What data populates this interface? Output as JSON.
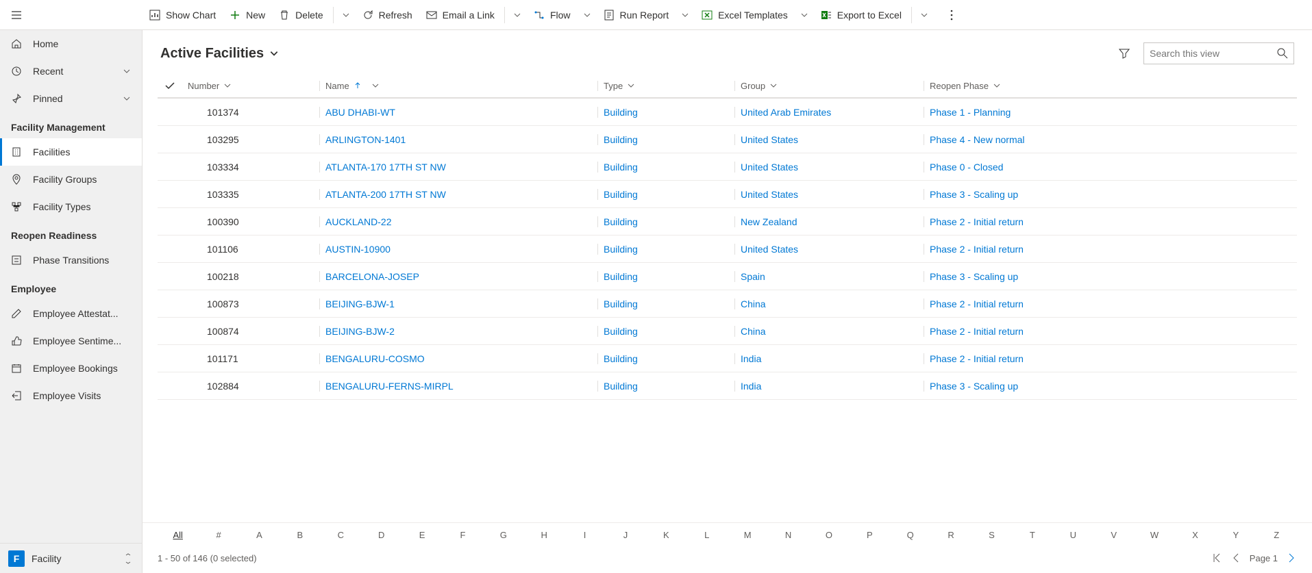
{
  "toolbar": {
    "show_chart": "Show Chart",
    "new": "New",
    "delete": "Delete",
    "refresh": "Refresh",
    "email_link": "Email a Link",
    "flow": "Flow",
    "run_report": "Run Report",
    "excel_templates": "Excel Templates",
    "export_excel": "Export to Excel"
  },
  "sidebar": {
    "top": [
      {
        "label": "Home"
      },
      {
        "label": "Recent"
      },
      {
        "label": "Pinned"
      }
    ],
    "groups": [
      {
        "title": "Facility Management",
        "items": [
          {
            "label": "Facilities",
            "active": true
          },
          {
            "label": "Facility Groups"
          },
          {
            "label": "Facility Types"
          }
        ]
      },
      {
        "title": "Reopen Readiness",
        "items": [
          {
            "label": "Phase Transitions"
          }
        ]
      },
      {
        "title": "Employee",
        "items": [
          {
            "label": "Employee Attestat..."
          },
          {
            "label": "Employee Sentime..."
          },
          {
            "label": "Employee Bookings"
          },
          {
            "label": "Employee Visits"
          }
        ]
      }
    ],
    "footer": {
      "badge": "F",
      "label": "Facility"
    }
  },
  "view": {
    "title": "Active Facilities",
    "search_placeholder": "Search this view"
  },
  "columns": {
    "number": "Number",
    "name": "Name",
    "type": "Type",
    "group": "Group",
    "phase": "Reopen Phase"
  },
  "rows": [
    {
      "number": "101374",
      "name": "ABU DHABI-WT",
      "type": "Building",
      "group": "United Arab Emirates",
      "phase": "Phase 1 - Planning"
    },
    {
      "number": "103295",
      "name": "ARLINGTON-1401",
      "type": "Building",
      "group": "United States",
      "phase": "Phase 4 - New normal"
    },
    {
      "number": "103334",
      "name": "ATLANTA-170 17TH ST NW",
      "type": "Building",
      "group": "United States",
      "phase": "Phase 0 - Closed"
    },
    {
      "number": "103335",
      "name": "ATLANTA-200 17TH ST NW",
      "type": "Building",
      "group": "United States",
      "phase": "Phase 3 - Scaling up"
    },
    {
      "number": "100390",
      "name": "AUCKLAND-22",
      "type": "Building",
      "group": "New Zealand",
      "phase": "Phase 2 - Initial return"
    },
    {
      "number": "101106",
      "name": "AUSTIN-10900",
      "type": "Building",
      "group": "United States",
      "phase": "Phase 2 - Initial return"
    },
    {
      "number": "100218",
      "name": "BARCELONA-JOSEP",
      "type": "Building",
      "group": "Spain",
      "phase": "Phase 3 - Scaling up"
    },
    {
      "number": "100873",
      "name": "BEIJING-BJW-1",
      "type": "Building",
      "group": "China",
      "phase": "Phase 2 - Initial return"
    },
    {
      "number": "100874",
      "name": "BEIJING-BJW-2",
      "type": "Building",
      "group": "China",
      "phase": "Phase 2 - Initial return"
    },
    {
      "number": "101171",
      "name": "BENGALURU-COSMO",
      "type": "Building",
      "group": "India",
      "phase": "Phase 2 - Initial return"
    },
    {
      "number": "102884",
      "name": "BENGALURU-FERNS-MIRPL",
      "type": "Building",
      "group": "India",
      "phase": "Phase 3 - Scaling up"
    }
  ],
  "alpha": [
    "All",
    "#",
    "A",
    "B",
    "C",
    "D",
    "E",
    "F",
    "G",
    "H",
    "I",
    "J",
    "K",
    "L",
    "M",
    "N",
    "O",
    "P",
    "Q",
    "R",
    "S",
    "T",
    "U",
    "V",
    "W",
    "X",
    "Y",
    "Z"
  ],
  "status": {
    "count": "1 - 50 of 146 (0 selected)",
    "page": "Page 1"
  }
}
